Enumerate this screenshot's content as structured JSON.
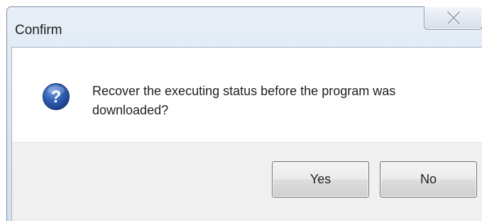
{
  "window": {
    "title": "Confirm",
    "close_icon": "close-icon"
  },
  "message": {
    "icon": "question-icon",
    "text": "Recover the executing status before the program was downloaded?"
  },
  "buttons": {
    "yes_label": "Yes",
    "no_label": "No"
  },
  "colors": {
    "icon_blue": "#2f5fb3",
    "button_area": "#f0f0f0"
  }
}
